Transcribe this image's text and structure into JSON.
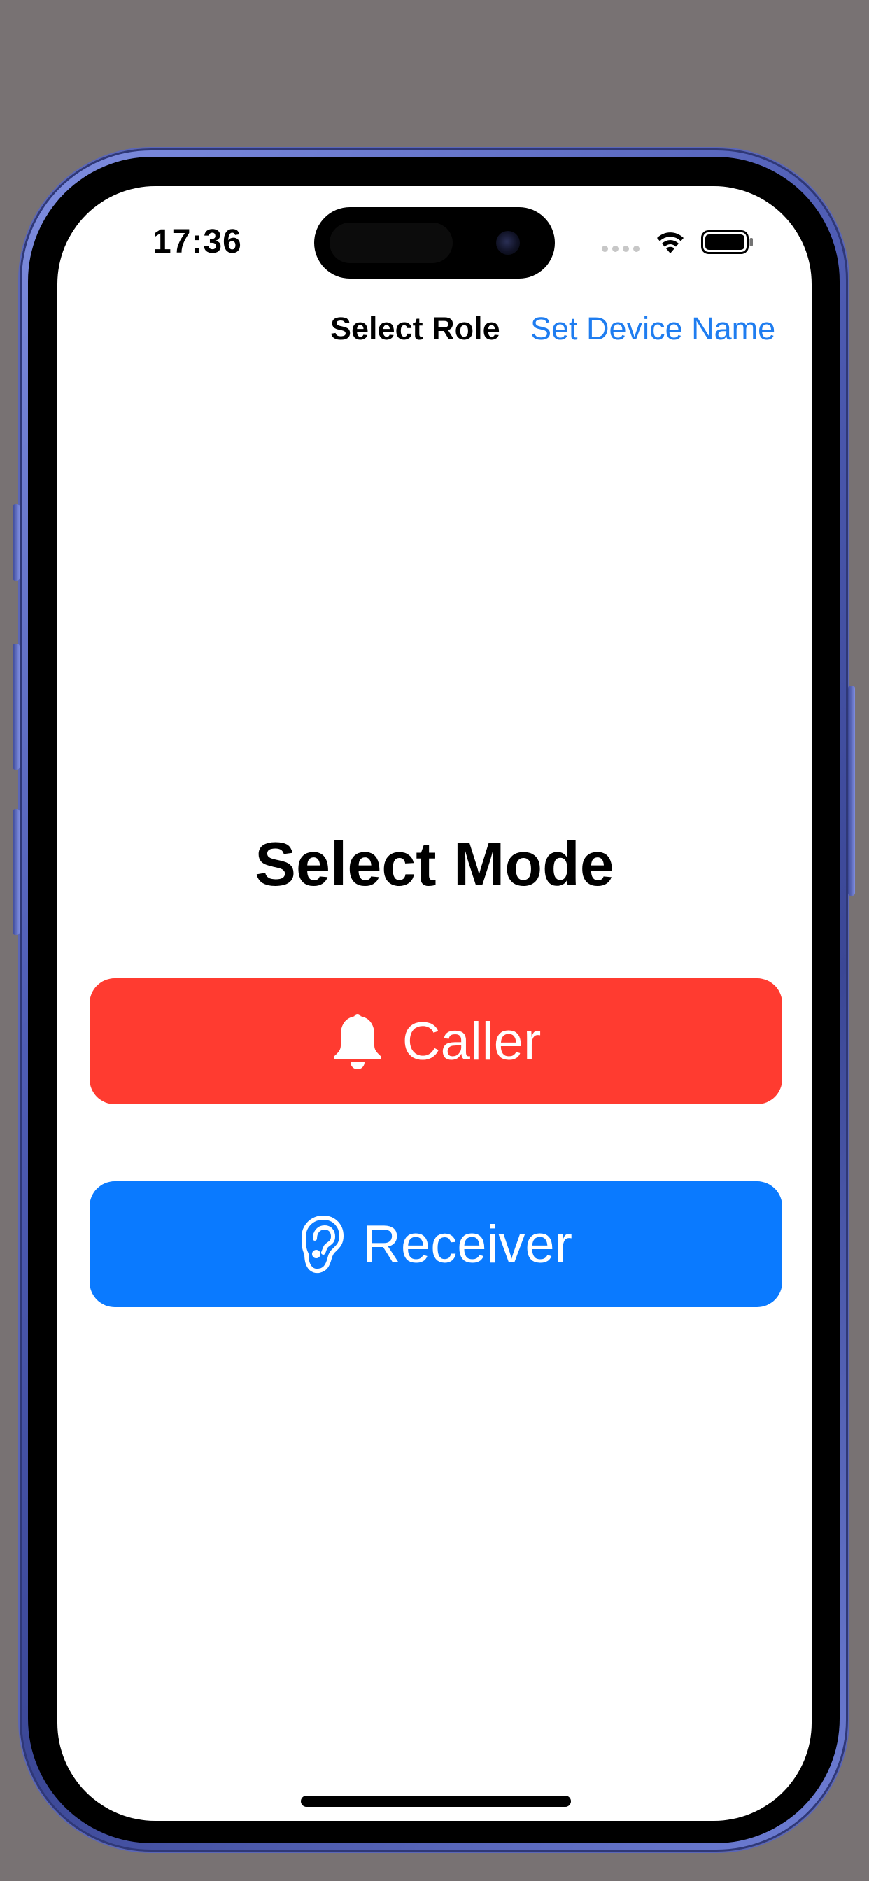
{
  "status_bar": {
    "time": "17:36",
    "icons": [
      "cellular-dots-icon",
      "wifi-icon",
      "battery-icon"
    ]
  },
  "nav": {
    "title": "Select Role",
    "link_label": "Set Device Name"
  },
  "main": {
    "heading": "Select Mode",
    "buttons": [
      {
        "label": "Caller",
        "icon": "bell-icon",
        "color": "#ff3b30"
      },
      {
        "label": "Receiver",
        "icon": "ear-icon",
        "color": "#0a7aff"
      }
    ]
  },
  "colors": {
    "link": "#1f7df0",
    "caller": "#ff3b30",
    "receiver": "#0a7aff",
    "frame": "#4f5db5"
  }
}
